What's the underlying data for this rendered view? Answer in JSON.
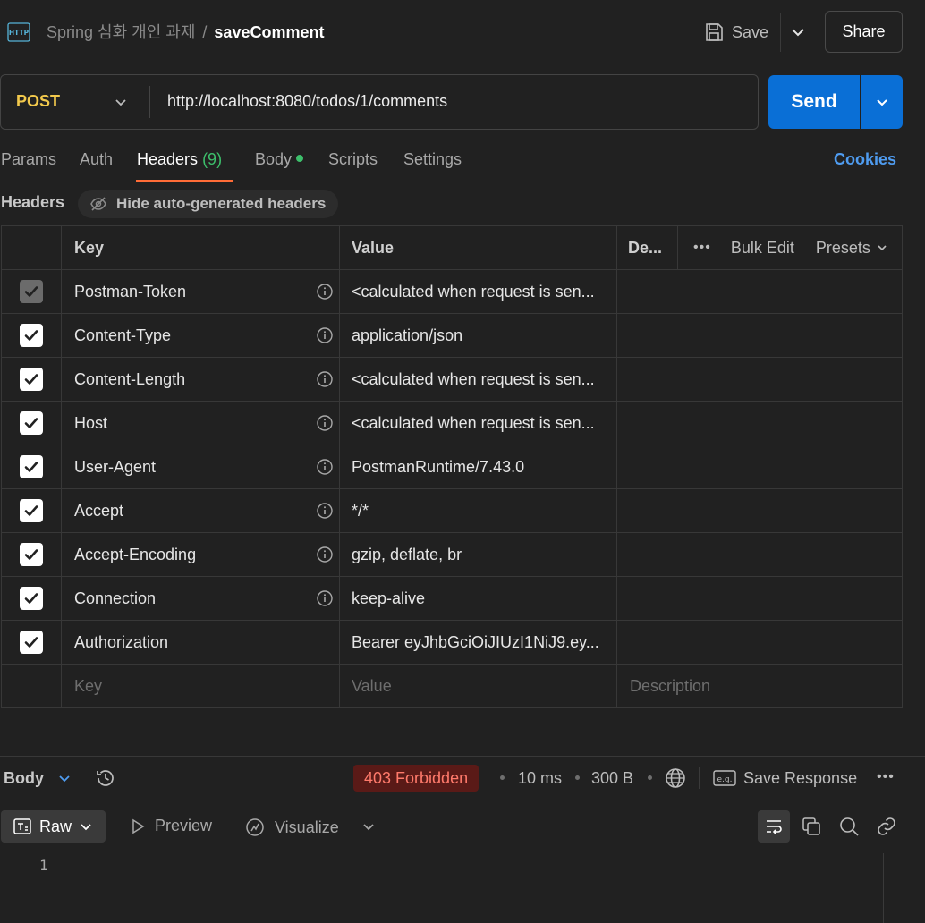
{
  "topbar": {
    "icon": "http-icon",
    "collection": "Spring 심화 개인 과제",
    "separator": "/",
    "request_name": "saveComment",
    "save_label": "Save",
    "share_label": "Share"
  },
  "request": {
    "method": "POST",
    "url": "http://localhost:8080/todos/1/comments",
    "send_label": "Send"
  },
  "tabs": {
    "params": "Params",
    "auth": "Auth",
    "headers": "Headers",
    "headers_count": "(9)",
    "body": "Body",
    "scripts": "Scripts",
    "settings": "Settings",
    "cookies": "Cookies",
    "active": "Headers"
  },
  "headers_section": {
    "label": "Headers",
    "hide_toggle": "Hide auto-generated headers"
  },
  "table": {
    "col_key": "Key",
    "col_value": "Value",
    "col_desc": "De...",
    "bulk_edit": "Bulk Edit",
    "presets": "Presets",
    "rows": [
      {
        "checked": true,
        "disabled": true,
        "key": "Postman-Token",
        "value": "<calculated when request is sen...",
        "info": true
      },
      {
        "checked": true,
        "disabled": false,
        "key": "Content-Type",
        "value": "application/json",
        "info": true
      },
      {
        "checked": true,
        "disabled": false,
        "key": "Content-Length",
        "value": "<calculated when request is sen...",
        "info": true
      },
      {
        "checked": true,
        "disabled": false,
        "key": "Host",
        "value": "<calculated when request is sen...",
        "info": true
      },
      {
        "checked": true,
        "disabled": false,
        "key": "User-Agent",
        "value": "PostmanRuntime/7.43.0",
        "info": true
      },
      {
        "checked": true,
        "disabled": false,
        "key": "Accept",
        "value": "*/*",
        "info": true
      },
      {
        "checked": true,
        "disabled": false,
        "key": "Accept-Encoding",
        "value": "gzip, deflate, br",
        "info": true
      },
      {
        "checked": true,
        "disabled": false,
        "key": "Connection",
        "value": "keep-alive",
        "info": true
      },
      {
        "checked": true,
        "disabled": false,
        "key": "Authorization",
        "value": "Bearer eyJhbGciOiJIUzI1NiJ9.ey...",
        "info": false
      }
    ],
    "placeholder_key": "Key",
    "placeholder_value": "Value",
    "placeholder_desc": "Description"
  },
  "response": {
    "body_label": "Body",
    "status": "403 Forbidden",
    "time": "10 ms",
    "size": "300 B",
    "save_response": "Save Response",
    "views": {
      "raw": "Raw",
      "preview": "Preview",
      "visualize": "Visualize"
    },
    "line_number": "1"
  },
  "colors": {
    "accent_orange": "#ff6c37",
    "send_blue": "#0a6fd6",
    "method_yellow": "#f2c94c",
    "status_error": "#ff7a6b",
    "count_green": "#3dbf6b"
  }
}
